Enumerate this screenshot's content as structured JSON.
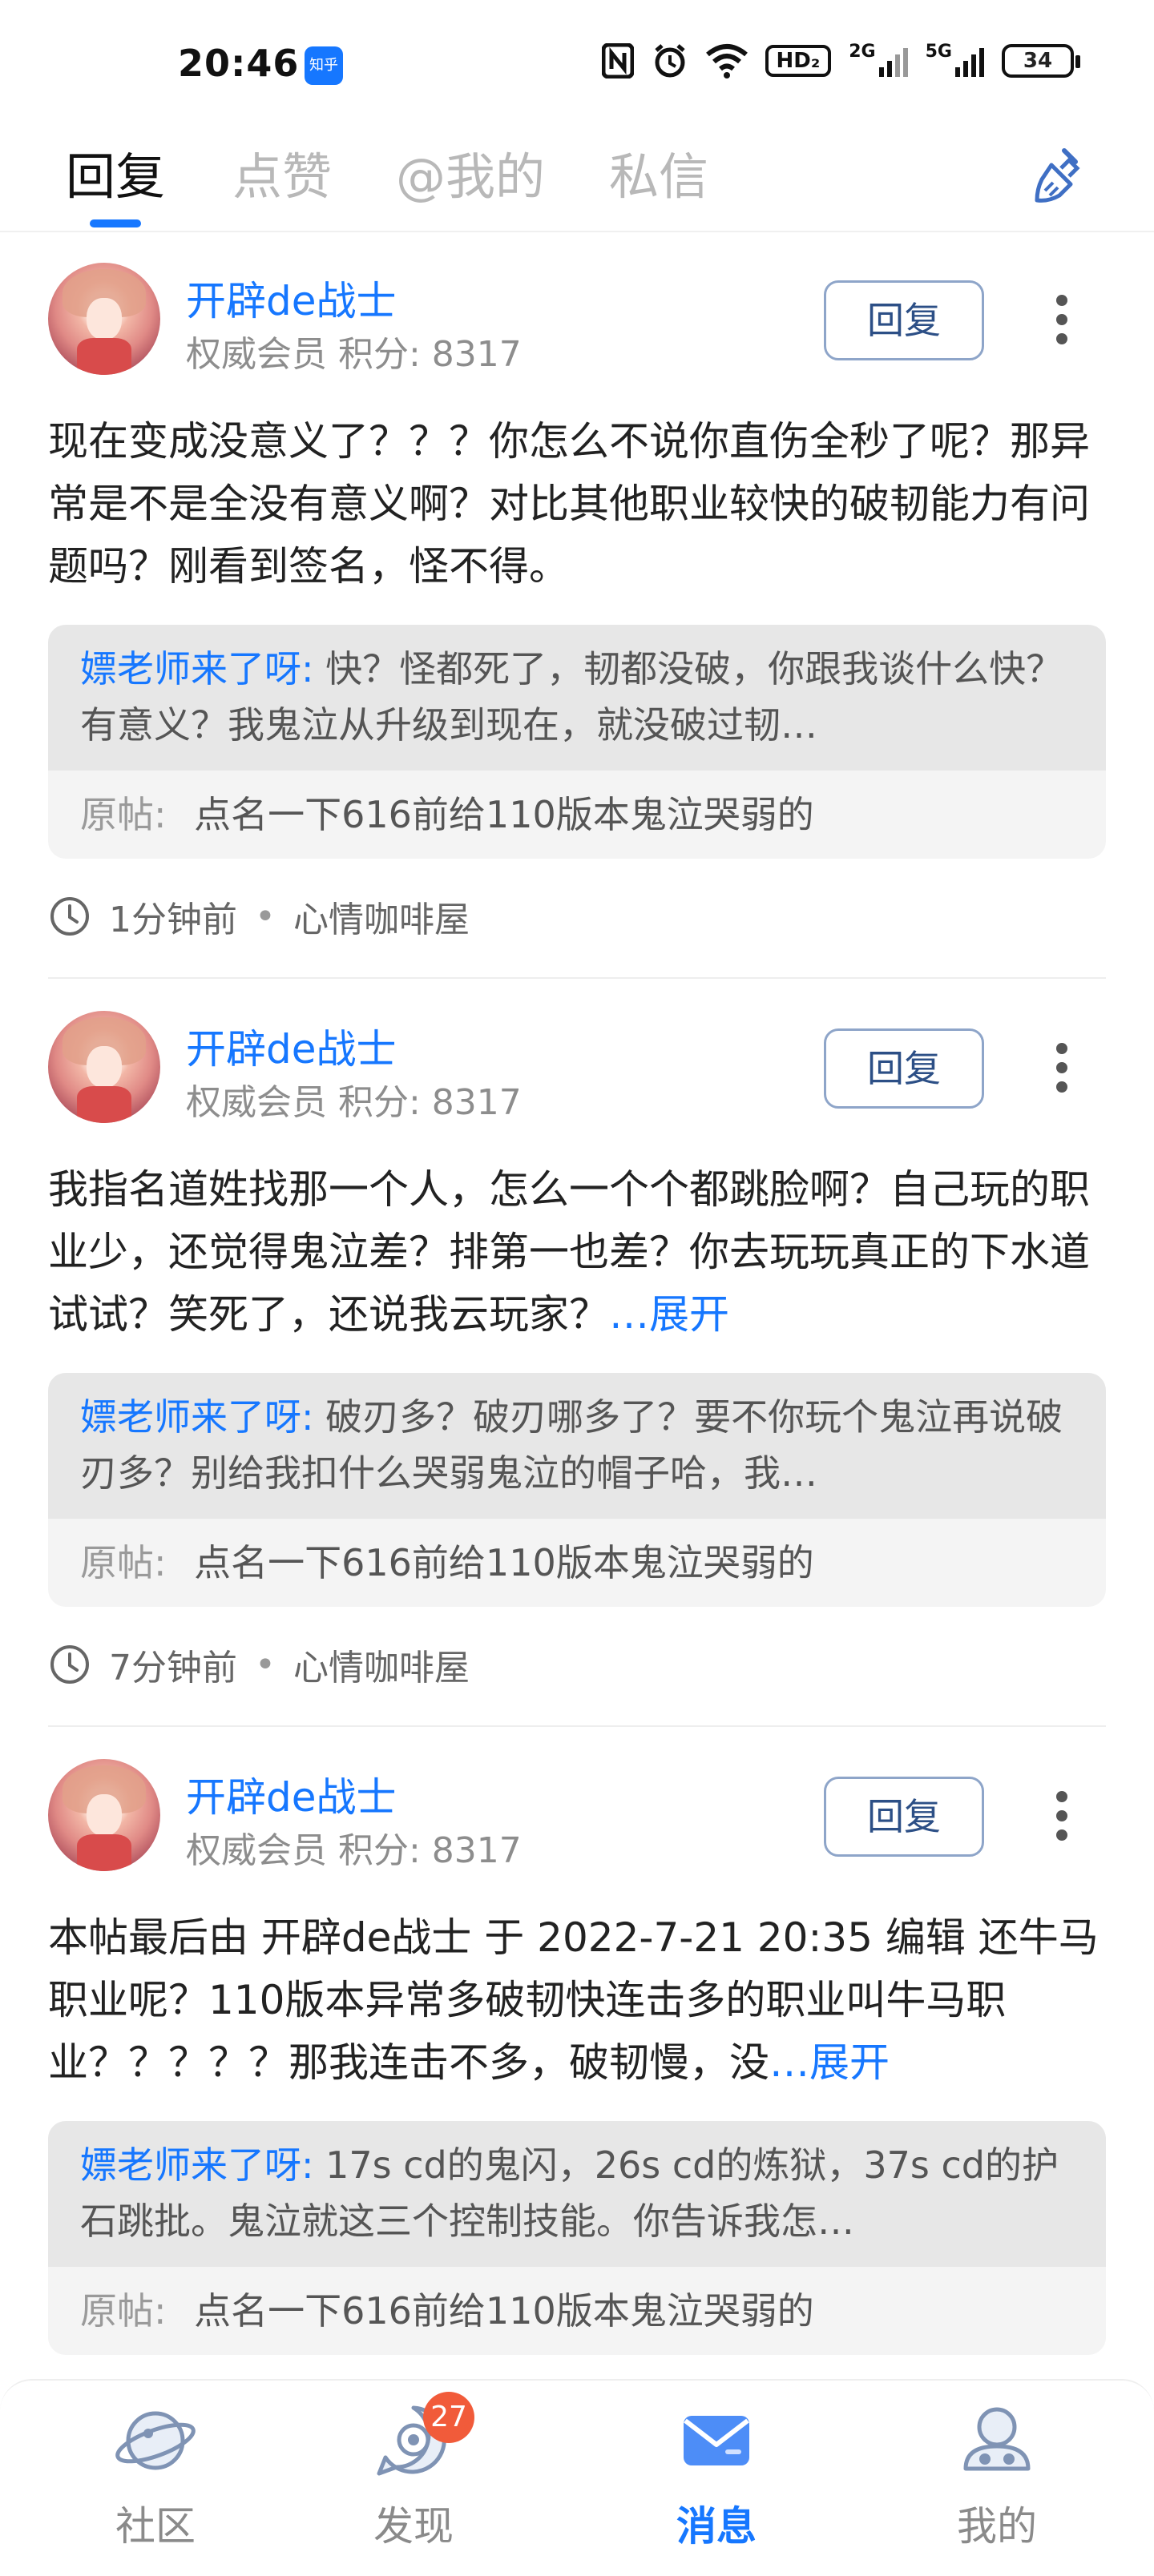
{
  "status_bar": {
    "time": "20:46",
    "app_badge": "知乎",
    "hd_label": "HD₂",
    "signal1": "2G",
    "signal2": "5G",
    "battery": "34"
  },
  "tabs": [
    {
      "label": "回复",
      "active": true
    },
    {
      "label": "点赞",
      "active": false
    },
    {
      "label": "@我的",
      "active": false
    },
    {
      "label": "私信",
      "active": false
    }
  ],
  "posts": [
    {
      "user": "开辟de战士",
      "meta": "权威会员  积分: 8317",
      "reply_label": "回复",
      "content": "现在变成没意义了？？？你怎么不说你直伤全秒了呢？那异常是不是全没有意义啊？对比其他职业较快的破韧能力有问题吗？刚看到签名，怪不得。",
      "expand": "",
      "quote_user": "嫖老师来了呀:",
      "quote_text": "快？怪都死了，韧都没破，你跟我谈什么快？有意义？我鬼泣从升级到现在，就没破过韧…",
      "origin_label": "原帖:",
      "origin_title": "点名一下616前给110版本鬼泣哭弱的",
      "time": "1分钟前",
      "forum": "心情咖啡屋"
    },
    {
      "user": "开辟de战士",
      "meta": "权威会员  积分: 8317",
      "reply_label": "回复",
      "content": "我指名道姓找那一个人，怎么一个个都跳脸啊？自己玩的职业少，还觉得鬼泣差？排第一也差？你去玩玩真正的下水道试试？笑死了，还说我云玩家？",
      "expand": "…展开",
      "quote_user": "嫖老师来了呀:",
      "quote_text": "破刃多？破刃哪多了？要不你玩个鬼泣再说破刃多？别给我扣什么哭弱鬼泣的帽子哈，我…",
      "origin_label": "原帖:",
      "origin_title": "点名一下616前给110版本鬼泣哭弱的",
      "time": "7分钟前",
      "forum": "心情咖啡屋"
    },
    {
      "user": "开辟de战士",
      "meta": "权威会员  积分: 8317",
      "reply_label": "回复",
      "content": "本帖最后由 开辟de战士 于 2022-7-21 20:35 编辑 还牛马职业呢？110版本异常多破韧快连击多的职业叫牛马职业？？？？？那我连击不多，破韧慢，没",
      "expand": "…展开",
      "quote_user": "嫖老师来了呀:",
      "quote_text": "17s cd的鬼闪，26s cd的炼狱，37s cd的护石跳批。鬼泣就这三个控制技能。你告诉我怎…",
      "origin_label": "原帖:",
      "origin_title": "点名一下616前给110版本鬼泣哭弱的",
      "time": "",
      "forum": ""
    }
  ],
  "footer_separator": "•",
  "bottom_nav": [
    {
      "label": "社区",
      "icon": "planet-icon",
      "active": false
    },
    {
      "label": "发现",
      "icon": "discover-icon",
      "active": false,
      "badge": "27"
    },
    {
      "label": "消息",
      "icon": "mail-icon",
      "active": true
    },
    {
      "label": "我的",
      "icon": "profile-icon",
      "active": false
    }
  ],
  "colors": {
    "accent": "#1677ff",
    "badge": "#f15b3a"
  }
}
